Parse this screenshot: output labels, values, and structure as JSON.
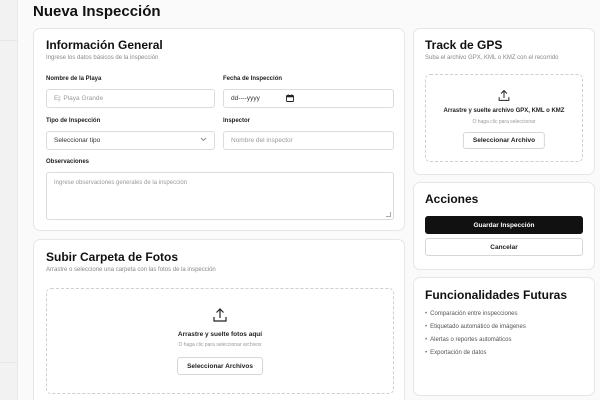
{
  "page": {
    "title": "Nueva Inspección"
  },
  "general": {
    "title": "Información General",
    "subtitle": "Ingrese los datos básicos de la inspección",
    "beach_label": "Nombre de la Playa",
    "beach_placeholder": "Ej: Playa Grande",
    "date_label": "Fecha de Inspección",
    "date_value": "dd----yyyy",
    "type_label": "Tipo de Inspección",
    "type_value": "Seleccionar tipo",
    "inspector_label": "Inspector",
    "inspector_placeholder": "Nombre del inspector",
    "notes_label": "Observaciones",
    "notes_placeholder": "Ingrese observaciones generales de la inspección"
  },
  "photos": {
    "title": "Subir Carpeta de Fotos",
    "subtitle": "Arrastre o seleccione una carpeta con las fotos de la inspección",
    "drop_title": "Arrastre y suelte fotos aquí",
    "drop_sub": "O haga clic para seleccionar archivos",
    "button": "Seleccionar Archivos"
  },
  "gps": {
    "title": "Track de GPS",
    "subtitle": "Suba el archivo GPX, KML o KMZ con el recorrido",
    "drop_title": "Arrastre y suelte archivo GPX, KML o KMZ",
    "drop_sub": "O haga clic para seleccionar",
    "button": "Seleccionar Archivo"
  },
  "actions": {
    "title": "Acciones",
    "save": "Guardar Inspección",
    "cancel": "Cancelar"
  },
  "future": {
    "title": "Funcionalidades Futuras",
    "items": [
      "Comparación entre inspecciones",
      "Etiquetado automático de imágenes",
      "Alertas o reportes automáticos",
      "Exportación de datos"
    ]
  },
  "icons": {
    "upload": "upload-icon",
    "calendar": "calendar-icon",
    "chevron": "chevron-down-icon"
  }
}
